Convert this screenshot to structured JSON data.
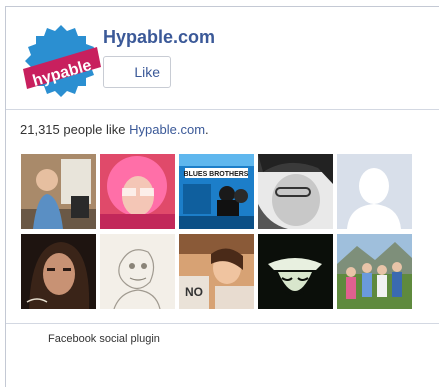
{
  "page": {
    "name": "Hypable.com",
    "logo_text": "hypable"
  },
  "like_button": {
    "label": "Like"
  },
  "fans": {
    "count": "21,315",
    "text_middle": " people like ",
    "page_link": "Hypable.com",
    "text_end": ".",
    "faces": [
      "fan-photo-1",
      "fan-photo-2",
      "fan-photo-3",
      "fan-photo-4",
      "fan-photo-default",
      "fan-photo-6",
      "fan-photo-7",
      "fan-photo-8",
      "fan-photo-9",
      "fan-photo-10"
    ],
    "face3_caption": "BLUES BROTHERS"
  },
  "footer": {
    "plugin_label": "Facebook social plugin"
  },
  "colors": {
    "brand_blue": "#3b5998",
    "logo_blue": "#2b8fd1",
    "logo_ribbon": "#c8205e"
  }
}
